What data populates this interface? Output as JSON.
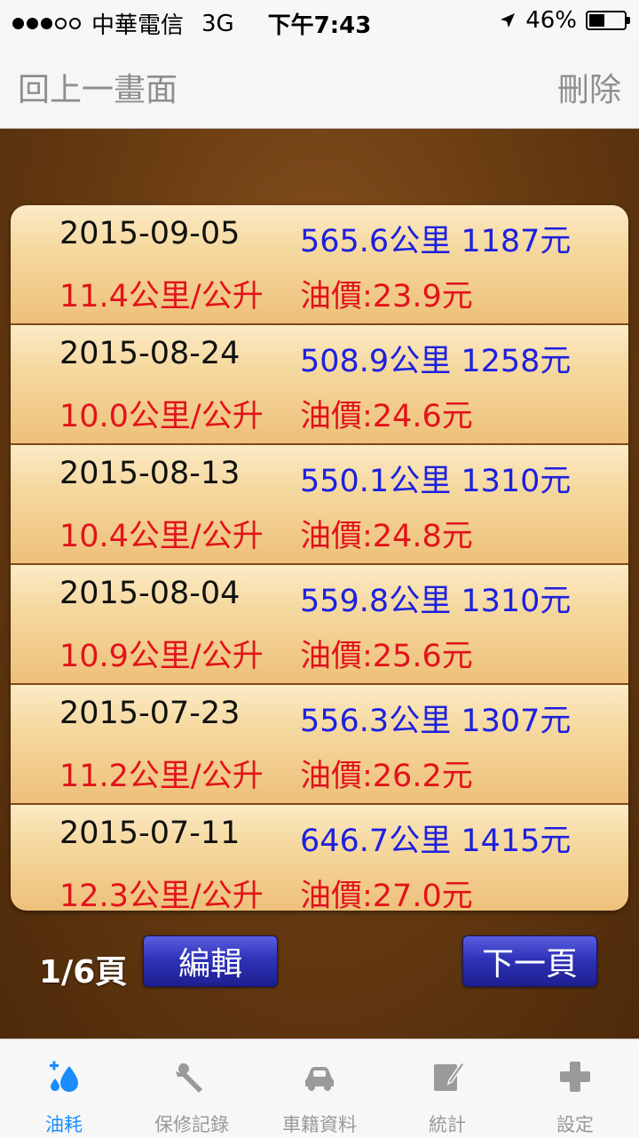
{
  "status_bar": {
    "carrier": "中華電信",
    "network": "3G",
    "time": "下午7:43",
    "battery": "46%",
    "battery_level": 0.46
  },
  "nav": {
    "back": "回上一畫面",
    "delete": "刪除"
  },
  "records": [
    {
      "date": "2015-09-05",
      "distance": "565.6公里 1187元",
      "efficiency": "11.4公里/公升",
      "price": "油價:23.9元"
    },
    {
      "date": "2015-08-24",
      "distance": "508.9公里 1258元",
      "efficiency": "10.0公里/公升",
      "price": "油價:24.6元"
    },
    {
      "date": "2015-08-13",
      "distance": "550.1公里 1310元",
      "efficiency": "10.4公里/公升",
      "price": "油價:24.8元"
    },
    {
      "date": "2015-08-04",
      "distance": "559.8公里 1310元",
      "efficiency": "10.9公里/公升",
      "price": "油價:25.6元"
    },
    {
      "date": "2015-07-23",
      "distance": "556.3公里 1307元",
      "efficiency": "11.2公里/公升",
      "price": "油價:26.2元"
    },
    {
      "date": "2015-07-11",
      "distance": "646.7公里 1415元",
      "efficiency": "12.3公里/公升",
      "price": "油價:27.0元"
    }
  ],
  "pager": {
    "page": "1/6頁",
    "edit": "編輯",
    "next": "下一頁"
  },
  "tabs": [
    {
      "label": "油耗",
      "icon": "fuel-drop-icon",
      "active": true
    },
    {
      "label": "保修記錄",
      "icon": "wrench-icon",
      "active": false
    },
    {
      "label": "車籍資料",
      "icon": "car-icon",
      "active": false
    },
    {
      "label": "統計",
      "icon": "clipboard-icon",
      "active": false
    },
    {
      "label": "設定",
      "icon": "plus-cross-icon",
      "active": false
    }
  ],
  "colors": {
    "date_text": "#111111",
    "distance_text": "#1d20e0",
    "efficiency_text": "#e2131b",
    "tab_active": "#1a8cff",
    "tab_inactive": "#999999"
  }
}
